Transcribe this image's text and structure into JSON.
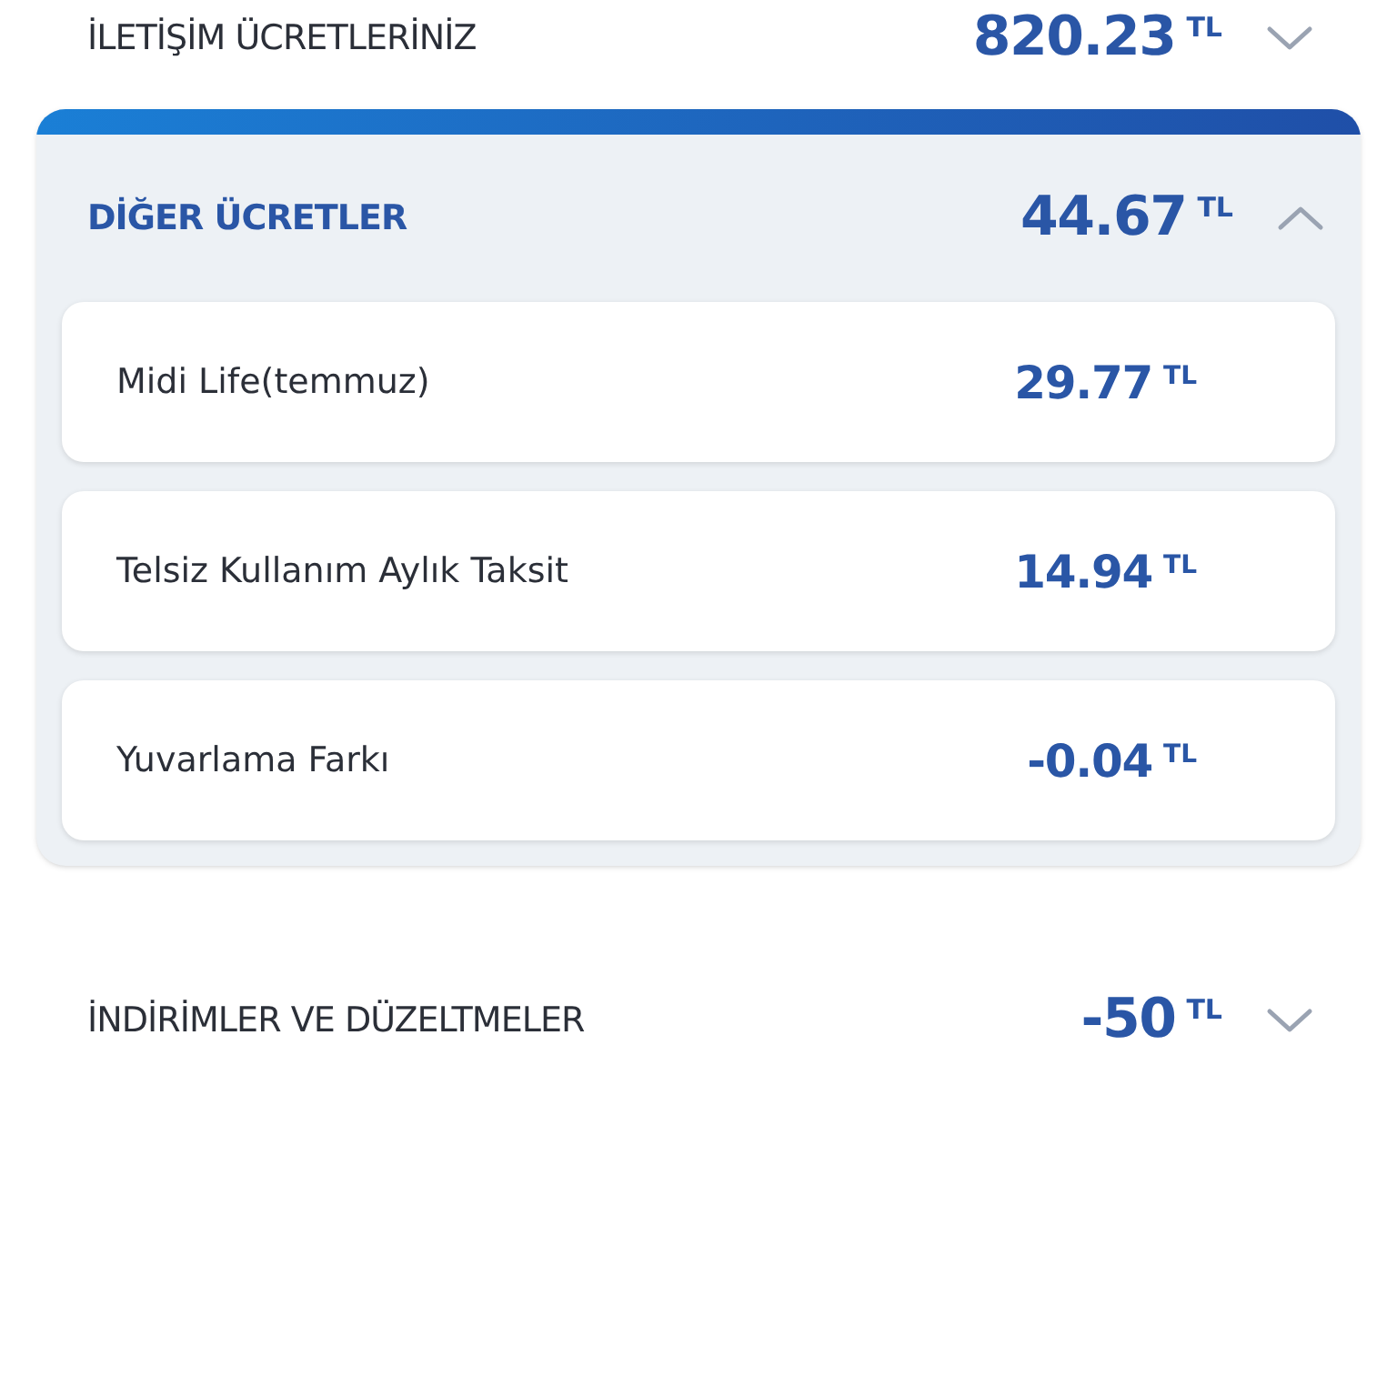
{
  "sections": [
    {
      "title": "İLETİŞİM ÜCRETLERİNİZ",
      "amount": "820.23",
      "currency": "TL",
      "expanded": false
    },
    {
      "title": "DİĞER ÜCRETLER",
      "amount": "44.67",
      "currency": "TL",
      "expanded": true,
      "items": [
        {
          "label": "Midi Life(temmuz)",
          "amount": "29.77",
          "currency": "TL"
        },
        {
          "label": "Telsiz Kullanım Aylık Taksit",
          "amount": "14.94",
          "currency": "TL"
        },
        {
          "label": "Yuvarlama Farkı",
          "amount": "-0.04",
          "currency": "TL"
        }
      ]
    },
    {
      "title": "İNDİRİMLER VE DÜZELTMELER",
      "amount": "-50",
      "currency": "TL",
      "expanded": false
    }
  ]
}
